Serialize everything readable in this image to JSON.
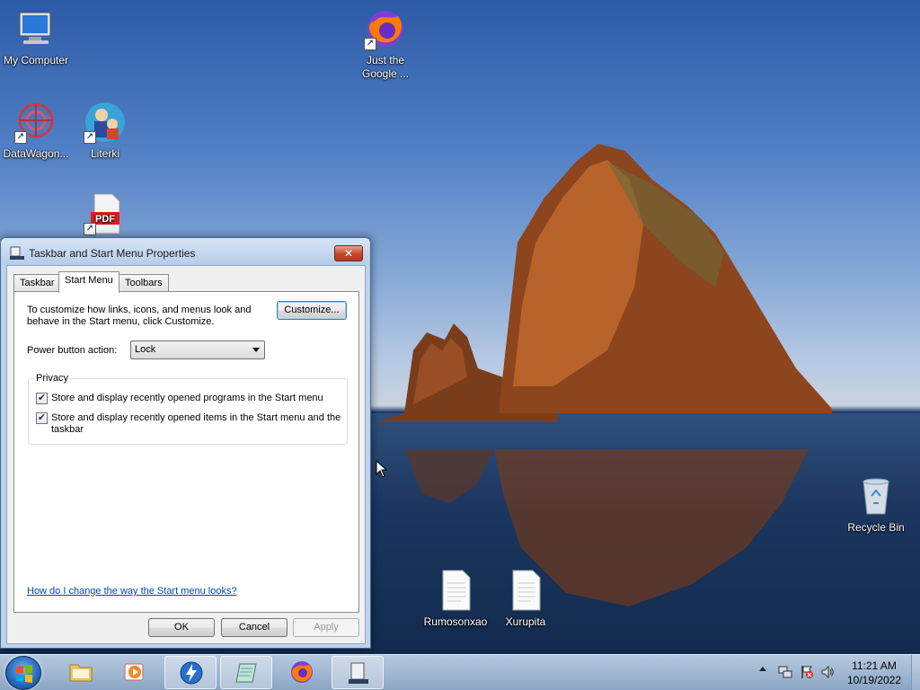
{
  "desktop": {
    "icons": [
      {
        "name": "my-computer",
        "label": "My Computer"
      },
      {
        "name": "firefox-shortcut",
        "label": "Just the Google ..."
      },
      {
        "name": "datawagon-shortcut",
        "label": "DataWagon..."
      },
      {
        "name": "literki-shortcut",
        "label": "Literki"
      },
      {
        "name": "pdf-shortcut",
        "label": ""
      },
      {
        "name": "recycle-bin",
        "label": "Recycle Bin"
      },
      {
        "name": "file-rumosonxao",
        "label": "Rumosonxao"
      },
      {
        "name": "file-xurupita",
        "label": "Xurupita"
      }
    ]
  },
  "dialog": {
    "title": "Taskbar and Start Menu Properties",
    "close_label": "✕",
    "tabs": [
      {
        "label": "Taskbar",
        "active": false
      },
      {
        "label": "Start Menu",
        "active": true
      },
      {
        "label": "Toolbars",
        "active": false
      }
    ],
    "description": "To customize how links, icons, and menus look and behave in the Start menu, click Customize.",
    "customize_label": "Customize...",
    "power_label": "Power button action:",
    "power_value": "Lock",
    "privacy_title": "Privacy",
    "checkboxes": [
      {
        "label": "Store and display recently opened programs in the Start menu",
        "checked": true
      },
      {
        "label": "Store and display recently opened items in the Start menu and the taskbar",
        "checked": true
      }
    ],
    "help_link": "How do I change the way the Start menu looks?",
    "ok_label": "OK",
    "cancel_label": "Cancel",
    "apply_label": "Apply"
  },
  "taskbar": {
    "clock_time": "11:21 AM",
    "clock_date": "10/19/2022"
  },
  "icons": {
    "check": "✔"
  }
}
